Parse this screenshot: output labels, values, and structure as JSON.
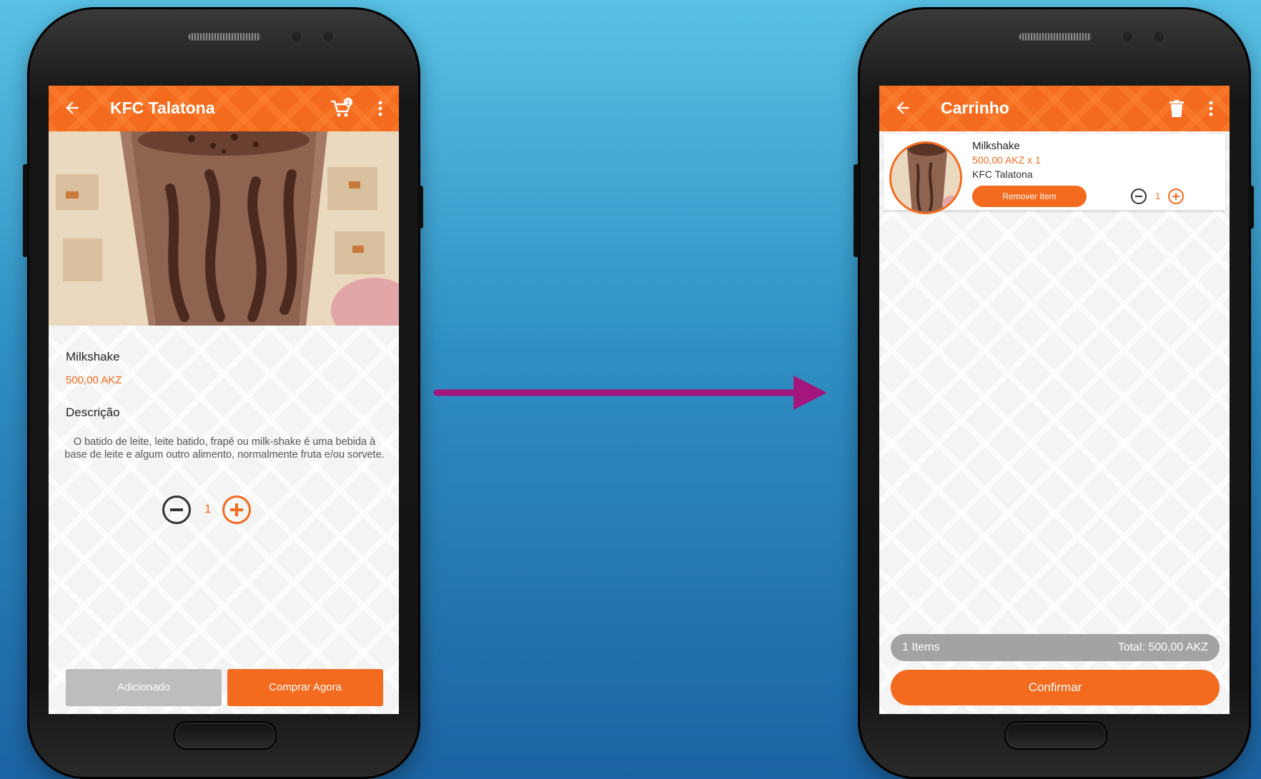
{
  "colors": {
    "accent": "#f46a1e",
    "arrow": "#a2167e",
    "disabled": "#bdbdbd",
    "summary_bar": "#a3a3a3"
  },
  "product_screen": {
    "title": "KFC Talatona",
    "cart_badge": "1",
    "icons": [
      "back-arrow-icon",
      "shopping-cart-icon",
      "more-vert-icon",
      "minus-circle-icon",
      "plus-circle-icon"
    ],
    "product": {
      "name": "Milkshake",
      "price": "500,00 AKZ",
      "description_title": "Descrição",
      "description": "O batido de leite, leite batido, frapé ou milk-shake é uma bebida à base de leite e algum outro alimento, normalmente fruta e/ou sorvete."
    },
    "quantity": "1",
    "buttons": {
      "added": "Adicionado",
      "buy_now": "Comprar Agora"
    }
  },
  "cart_screen": {
    "title": "Carrinho",
    "icons": [
      "back-arrow-icon",
      "trash-icon",
      "more-vert-icon",
      "minus-circle-icon",
      "plus-circle-icon"
    ],
    "items": [
      {
        "name": "Milkshake",
        "price_line": "500,00 AKZ x 1",
        "store": "KFC Talatona",
        "remove_label": "Remover Item",
        "quantity": "1"
      }
    ],
    "summary": {
      "items": "1 Items",
      "total": "Total: 500,00 AKZ"
    },
    "confirm_label": "Confirmar"
  }
}
